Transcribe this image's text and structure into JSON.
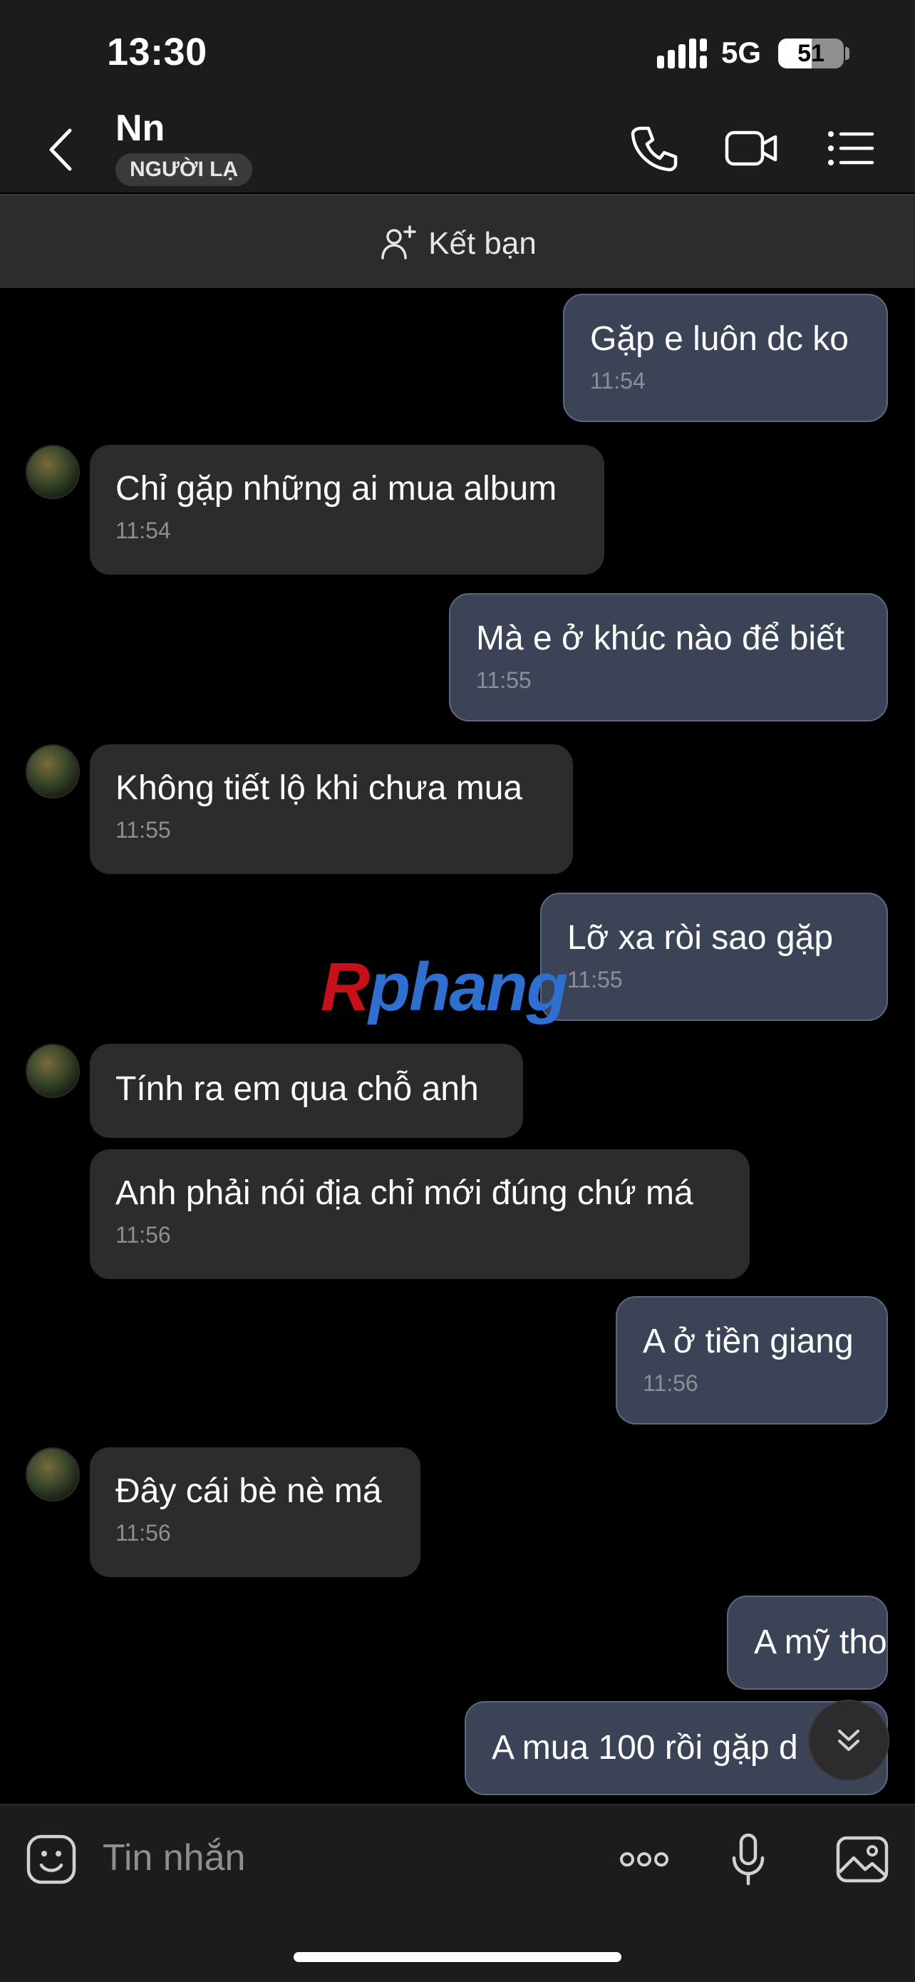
{
  "status_bar": {
    "time": "13:30",
    "network": "5G",
    "battery": "51",
    "battery_level": 0.51
  },
  "header": {
    "contact_name": "Nn",
    "badge": "NGƯỜI LẠ"
  },
  "friend_bar": {
    "label": "Kết bạn"
  },
  "messages": [
    {
      "text": "Gặp e luôn dc ko",
      "time": "11:54"
    },
    {
      "text": "Chỉ gặp những ai mua album",
      "time": "11:54"
    },
    {
      "text": "Mà e ở khúc nào để biết",
      "time": "11:55"
    },
    {
      "text": "Không tiết lộ khi chưa mua",
      "time": "11:55"
    },
    {
      "text": "Lỡ xa ròi sao gặp",
      "time": "11:55"
    },
    {
      "text": "Tính ra em qua chỗ anh",
      "time": ""
    },
    {
      "text": "Anh phải nói địa chỉ mới đúng chứ má",
      "time": "11:56"
    },
    {
      "text": "A ở tiền giang",
      "time": "11:56"
    },
    {
      "text": "Đây cái bè nè má",
      "time": "11:56"
    },
    {
      "text": "A mỹ tho",
      "time": ""
    },
    {
      "text": "A mua 100 rồi gặp d",
      "time": ""
    }
  ],
  "watermark": {
    "first": "R",
    "rest": "phang"
  },
  "composer": {
    "placeholder": "Tin nhắn"
  },
  "colors": {
    "outgoing_bubble": "#3a4456",
    "incoming_bubble": "#2c2c2e",
    "background": "#000000"
  }
}
